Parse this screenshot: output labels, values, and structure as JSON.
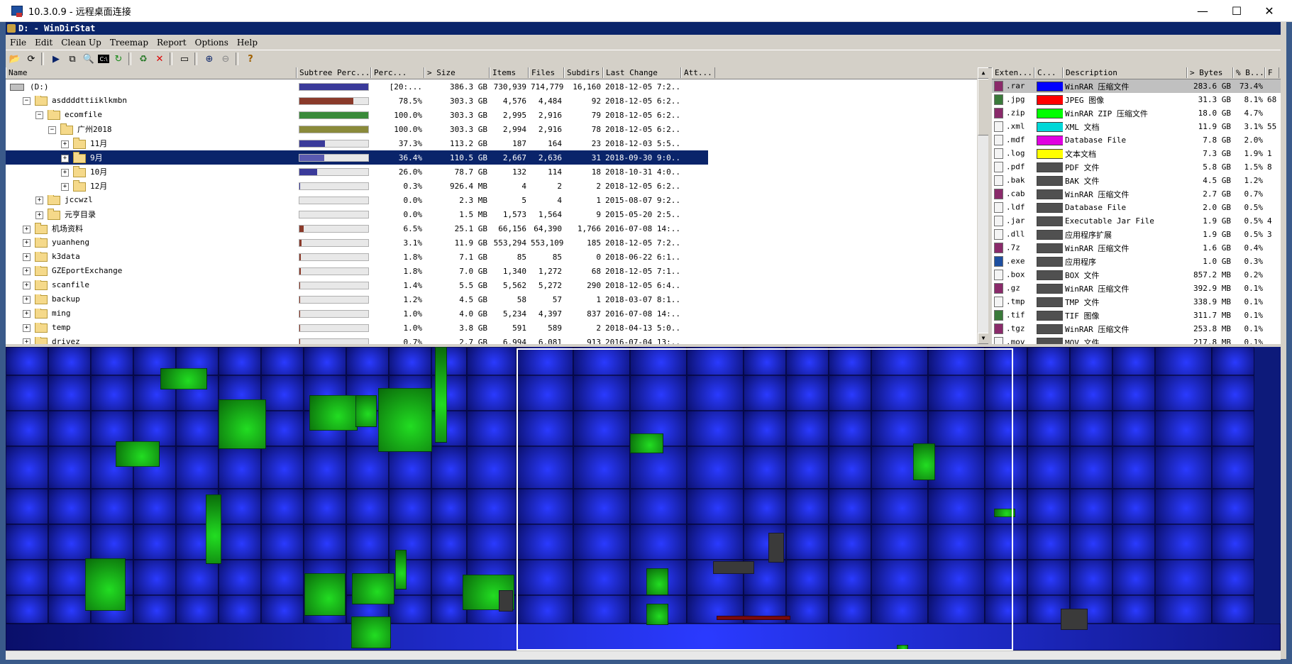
{
  "rdp": {
    "title": "10.3.0.9 - 远程桌面连接",
    "minimize": "—",
    "maximize": "☐",
    "close": "✕"
  },
  "app": {
    "title": "D: - WinDirStat",
    "menu": [
      "File",
      "Edit",
      "Clean Up",
      "Treemap",
      "Report",
      "Options",
      "Help"
    ]
  },
  "tree": {
    "columns": [
      "Name",
      "Subtree Perc...",
      "Perc...",
      "> Size",
      "Items",
      "Files",
      "Subdirs",
      "Last Change",
      "Att..."
    ],
    "rows": [
      {
        "name": "(D:)",
        "indent": 0,
        "exp": "",
        "icon": "drive",
        "bar": 1.0,
        "barColor": "#3a3a9a",
        "perc": "[20:...",
        "size": "386.3 GB",
        "items": "730,939",
        "files": "714,779",
        "subdirs": "16,160",
        "last": "2018-12-05  7:2..."
      },
      {
        "name": "asddddttiiklkmbn",
        "indent": 1,
        "exp": "⊟",
        "icon": "folder",
        "bar": 0.785,
        "barColor": "#8a3a2a",
        "perc": "78.5%",
        "size": "303.3 GB",
        "items": "4,576",
        "files": "4,484",
        "subdirs": "92",
        "last": "2018-12-05  6:2..."
      },
      {
        "name": "ecomfile",
        "indent": 2,
        "exp": "⊟",
        "icon": "folder",
        "bar": 1.0,
        "barColor": "#3a8a3a",
        "perc": "100.0%",
        "size": "303.3 GB",
        "items": "2,995",
        "files": "2,916",
        "subdirs": "79",
        "last": "2018-12-05  6:2..."
      },
      {
        "name": "广州2018",
        "indent": 3,
        "exp": "⊟",
        "icon": "folder",
        "bar": 1.0,
        "barColor": "#8a8a3a",
        "perc": "100.0%",
        "size": "303.3 GB",
        "items": "2,994",
        "files": "2,916",
        "subdirs": "78",
        "last": "2018-12-05  6:2..."
      },
      {
        "name": "11月",
        "indent": 4,
        "exp": "⊞",
        "icon": "folder",
        "bar": 0.373,
        "barColor": "#3a3a9a",
        "perc": "37.3%",
        "size": "113.2 GB",
        "items": "187",
        "files": "164",
        "subdirs": "23",
        "last": "2018-12-03  5:5..."
      },
      {
        "name": "9月",
        "indent": 4,
        "exp": "⊞",
        "icon": "folder",
        "bar": 0.364,
        "barColor": "#3a3a9a",
        "perc": "36.4%",
        "size": "110.5 GB",
        "items": "2,667",
        "files": "2,636",
        "subdirs": "31",
        "last": "2018-09-30  9:0...",
        "selected": true
      },
      {
        "name": "10月",
        "indent": 4,
        "exp": "⊞",
        "icon": "folder",
        "bar": 0.26,
        "barColor": "#3a3a9a",
        "perc": "26.0%",
        "size": "78.7 GB",
        "items": "132",
        "files": "114",
        "subdirs": "18",
        "last": "2018-10-31  4:0..."
      },
      {
        "name": "12月",
        "indent": 4,
        "exp": "⊞",
        "icon": "folder",
        "bar": 0.003,
        "barColor": "#3a3a9a",
        "perc": "0.3%",
        "size": "926.4 MB",
        "items": "4",
        "files": "2",
        "subdirs": "2",
        "last": "2018-12-05  6:2..."
      },
      {
        "name": "jccwzl",
        "indent": 2,
        "exp": "⊞",
        "icon": "folder",
        "bar": 0.0,
        "barColor": "#3a8a3a",
        "perc": "0.0%",
        "size": "2.3 MB",
        "items": "5",
        "files": "4",
        "subdirs": "1",
        "last": "2015-08-07  9:2..."
      },
      {
        "name": "元亨目录",
        "indent": 2,
        "exp": "⊞",
        "icon": "folder",
        "bar": 0.0,
        "barColor": "#3a8a3a",
        "perc": "0.0%",
        "size": "1.5 MB",
        "items": "1,573",
        "files": "1,564",
        "subdirs": "9",
        "last": "2015-05-20  2:5..."
      },
      {
        "name": "机场资料",
        "indent": 1,
        "exp": "⊞",
        "icon": "folder",
        "bar": 0.065,
        "barColor": "#8a3a2a",
        "perc": "6.5%",
        "size": "25.1 GB",
        "items": "66,156",
        "files": "64,390",
        "subdirs": "1,766",
        "last": "2016-07-08  14:..."
      },
      {
        "name": "yuanheng",
        "indent": 1,
        "exp": "⊞",
        "icon": "folder",
        "bar": 0.031,
        "barColor": "#8a3a2a",
        "perc": "3.1%",
        "size": "11.9 GB",
        "items": "553,294",
        "files": "553,109",
        "subdirs": "185",
        "last": "2018-12-05  7:2..."
      },
      {
        "name": "k3data",
        "indent": 1,
        "exp": "⊞",
        "icon": "folder",
        "bar": 0.018,
        "barColor": "#8a3a2a",
        "perc": "1.8%",
        "size": "7.1 GB",
        "items": "85",
        "files": "85",
        "subdirs": "0",
        "last": "2018-06-22  6:1..."
      },
      {
        "name": "GZEportExchange",
        "indent": 1,
        "exp": "⊞",
        "icon": "folder",
        "bar": 0.018,
        "barColor": "#8a3a2a",
        "perc": "1.8%",
        "size": "7.0 GB",
        "items": "1,340",
        "files": "1,272",
        "subdirs": "68",
        "last": "2018-12-05  7:1..."
      },
      {
        "name": "scanfile",
        "indent": 1,
        "exp": "⊞",
        "icon": "folder",
        "bar": 0.014,
        "barColor": "#8a3a2a",
        "perc": "1.4%",
        "size": "5.5 GB",
        "items": "5,562",
        "files": "5,272",
        "subdirs": "290",
        "last": "2018-12-05  6:4..."
      },
      {
        "name": "backup",
        "indent": 1,
        "exp": "⊞",
        "icon": "folder",
        "bar": 0.012,
        "barColor": "#8a3a2a",
        "perc": "1.2%",
        "size": "4.5 GB",
        "items": "58",
        "files": "57",
        "subdirs": "1",
        "last": "2018-03-07  8:1..."
      },
      {
        "name": "ming",
        "indent": 1,
        "exp": "⊞",
        "icon": "folder",
        "bar": 0.01,
        "barColor": "#8a3a2a",
        "perc": "1.0%",
        "size": "4.0 GB",
        "items": "5,234",
        "files": "4,397",
        "subdirs": "837",
        "last": "2016-07-08  14:..."
      },
      {
        "name": "temp",
        "indent": 1,
        "exp": "⊞",
        "icon": "folder",
        "bar": 0.01,
        "barColor": "#8a3a2a",
        "perc": "1.0%",
        "size": "3.8 GB",
        "items": "591",
        "files": "589",
        "subdirs": "2",
        "last": "2018-04-13  5:0..."
      },
      {
        "name": "drivez",
        "indent": 1,
        "exp": "⊞",
        "icon": "folder",
        "bar": 0.007,
        "barColor": "#8a3a2a",
        "perc": "0.7%",
        "size": "2.7 GB",
        "items": "6,994",
        "files": "6,081",
        "subdirs": "913",
        "last": "2016-07-04  13:..."
      }
    ]
  },
  "ext": {
    "columns": [
      "Exten...",
      "C...",
      "Description",
      "> Bytes",
      "% B...",
      "F"
    ],
    "rows": [
      {
        "ext": ".rar",
        "color": "#0000ff",
        "desc": "WinRAR 压缩文件",
        "bytes": "283.6 GB",
        "pct": "73.4%",
        "extra": "",
        "icon": "rar",
        "selected": true
      },
      {
        "ext": ".jpg",
        "color": "#ff0000",
        "desc": "JPEG 图像",
        "bytes": "31.3 GB",
        "pct": "8.1%",
        "extra": "68",
        "icon": "img"
      },
      {
        "ext": ".zip",
        "color": "#00ff00",
        "desc": "WinRAR ZIP 压缩文件",
        "bytes": "18.0 GB",
        "pct": "4.7%",
        "extra": "",
        "icon": "rar"
      },
      {
        "ext": ".xml",
        "color": "#00d8d8",
        "desc": "XML 文档",
        "bytes": "11.9 GB",
        "pct": "3.1%",
        "extra": "55",
        "icon": "doc"
      },
      {
        "ext": ".mdf",
        "color": "#e000e0",
        "desc": "Database File",
        "bytes": "7.8 GB",
        "pct": "2.0%",
        "extra": "",
        "icon": "doc"
      },
      {
        "ext": ".log",
        "color": "#ffff00",
        "desc": "文本文档",
        "bytes": "7.3 GB",
        "pct": "1.9%",
        "extra": "1",
        "icon": "doc"
      },
      {
        "ext": ".pdf",
        "color": "#505050",
        "desc": "PDF 文件",
        "bytes": "5.8 GB",
        "pct": "1.5%",
        "extra": "8",
        "icon": "doc"
      },
      {
        "ext": ".bak",
        "color": "#505050",
        "desc": "BAK 文件",
        "bytes": "4.5 GB",
        "pct": "1.2%",
        "extra": "",
        "icon": "doc"
      },
      {
        "ext": ".cab",
        "color": "#505050",
        "desc": "WinRAR 压缩文件",
        "bytes": "2.7 GB",
        "pct": "0.7%",
        "extra": "",
        "icon": "rar"
      },
      {
        "ext": ".ldf",
        "color": "#505050",
        "desc": "Database File",
        "bytes": "2.0 GB",
        "pct": "0.5%",
        "extra": "",
        "icon": "doc"
      },
      {
        "ext": ".jar",
        "color": "#505050",
        "desc": "Executable Jar File",
        "bytes": "1.9 GB",
        "pct": "0.5%",
        "extra": "4",
        "icon": "doc"
      },
      {
        "ext": ".dll",
        "color": "#505050",
        "desc": "应用程序扩展",
        "bytes": "1.9 GB",
        "pct": "0.5%",
        "extra": "3",
        "icon": "doc"
      },
      {
        "ext": ".7z",
        "color": "#505050",
        "desc": "WinRAR 压缩文件",
        "bytes": "1.6 GB",
        "pct": "0.4%",
        "extra": "",
        "icon": "rar"
      },
      {
        "ext": ".exe",
        "color": "#505050",
        "desc": "应用程序",
        "bytes": "1.0 GB",
        "pct": "0.3%",
        "extra": "",
        "icon": "exe"
      },
      {
        "ext": ".box",
        "color": "#505050",
        "desc": "BOX 文件",
        "bytes": "857.2 MB",
        "pct": "0.2%",
        "extra": "",
        "icon": "doc"
      },
      {
        "ext": ".gz",
        "color": "#505050",
        "desc": "WinRAR 压缩文件",
        "bytes": "392.9 MB",
        "pct": "0.1%",
        "extra": "",
        "icon": "rar"
      },
      {
        "ext": ".tmp",
        "color": "#505050",
        "desc": "TMP 文件",
        "bytes": "338.9 MB",
        "pct": "0.1%",
        "extra": "",
        "icon": "doc"
      },
      {
        "ext": ".tif",
        "color": "#505050",
        "desc": "TIF 图像",
        "bytes": "311.7 MB",
        "pct": "0.1%",
        "extra": "",
        "icon": "img"
      },
      {
        "ext": ".tgz",
        "color": "#505050",
        "desc": "WinRAR 压缩文件",
        "bytes": "253.8 MB",
        "pct": "0.1%",
        "extra": "",
        "icon": "rar"
      },
      {
        "ext": ".mov",
        "color": "#505050",
        "desc": "MOV 文件",
        "bytes": "217.8 MB",
        "pct": "0.1%",
        "extra": "",
        "icon": "doc"
      }
    ]
  },
  "toolbar": {
    "icons": [
      "open-icon",
      "refresh-icon",
      "run-icon",
      "copy-icon",
      "explorer-icon",
      "cmd-icon",
      "rescan-icon",
      "recycle-icon",
      "delete-icon",
      "properties-icon",
      "zoom-in-icon",
      "zoom-out-icon",
      "help-icon"
    ]
  }
}
